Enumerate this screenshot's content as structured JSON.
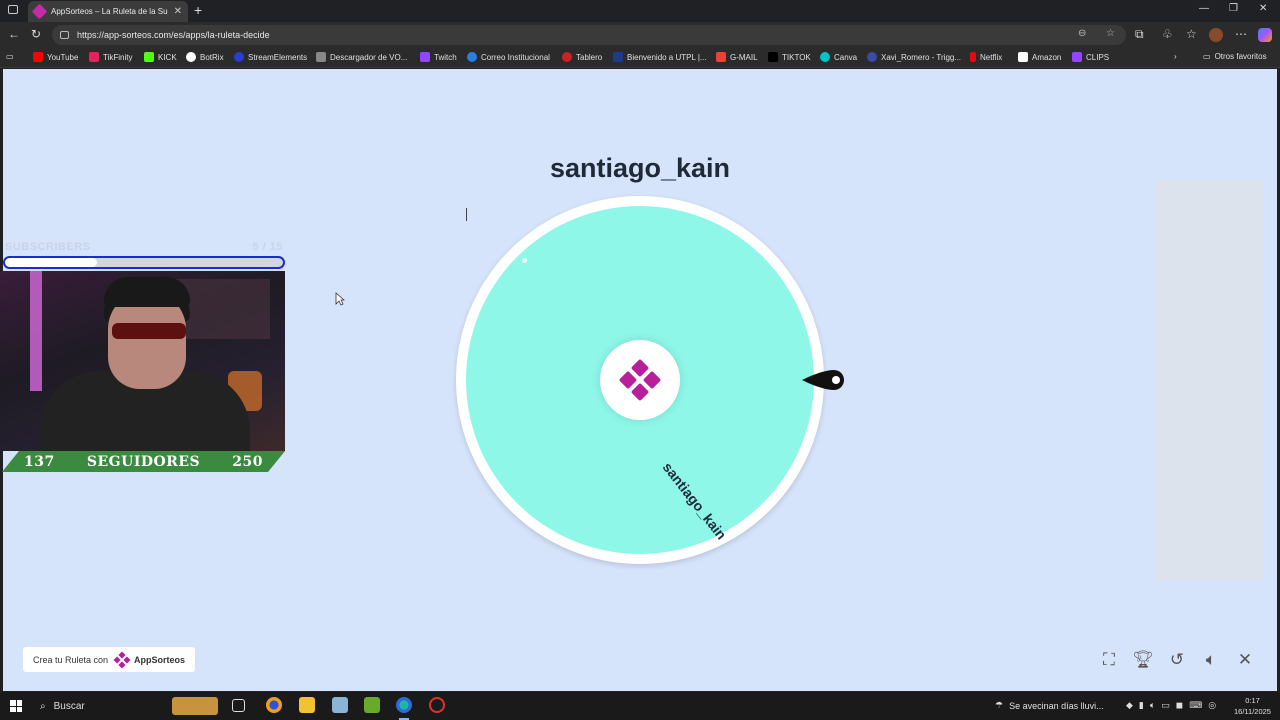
{
  "browser": {
    "tab_title": "AppSorteos – La Ruleta de la Suerte",
    "url": "https://app-sorteos.com/es/apps/la-ruleta-decide",
    "bookmarks": [
      {
        "label": "YouTube",
        "color": "#ff0000"
      },
      {
        "label": "TikFinity",
        "color": "#e0245e"
      },
      {
        "label": "KICK",
        "color": "#53fc18"
      },
      {
        "label": "BotRix",
        "color": "#ffffff"
      },
      {
        "label": "StreamElements",
        "color": "#2a3bd6"
      },
      {
        "label": "Descargador de VO...",
        "color": "#888888"
      },
      {
        "label": "Twitch",
        "color": "#9146ff"
      },
      {
        "label": "Correo Institucional",
        "color": "#2a7de1"
      },
      {
        "label": "Tablero",
        "color": "#cc2222"
      },
      {
        "label": "Bienvenido a UTPL |...",
        "color": "#1e3a8a"
      },
      {
        "label": "G-MAIL",
        "color": "#ea4335"
      },
      {
        "label": "TIKTOK",
        "color": "#000000"
      },
      {
        "label": "Canva",
        "color": "#00c4cc"
      },
      {
        "label": "Xavi_Romero - Trigg...",
        "color": "#3b4ba8"
      },
      {
        "label": "Netflix",
        "color": "#e50914"
      },
      {
        "label": "Amazon",
        "color": "#ffffff"
      },
      {
        "label": "CLIPS",
        "color": "#9146ff"
      }
    ],
    "other_bookmarks": "Otros favoritos"
  },
  "page": {
    "winner_name": "santiago_kain",
    "slice_label": "santiago_kain",
    "credit_prefix": "Crea tu Ruleta con",
    "credit_brand": "AppSorteos",
    "wheel_color": "#8ef7e8",
    "brand_color": "#b81f9b"
  },
  "overlay": {
    "subs_label": "SUBSCRIBERS",
    "subs_count": "5 / 15",
    "subs_progress": 0.33,
    "followers_current": "137",
    "followers_label": "SEGUIDORES",
    "followers_goal": "250"
  },
  "taskbar": {
    "search_placeholder": "Buscar",
    "weather_text": "Se avecinan días lluvi...",
    "time": "0:17",
    "date": "16/11/2025"
  }
}
